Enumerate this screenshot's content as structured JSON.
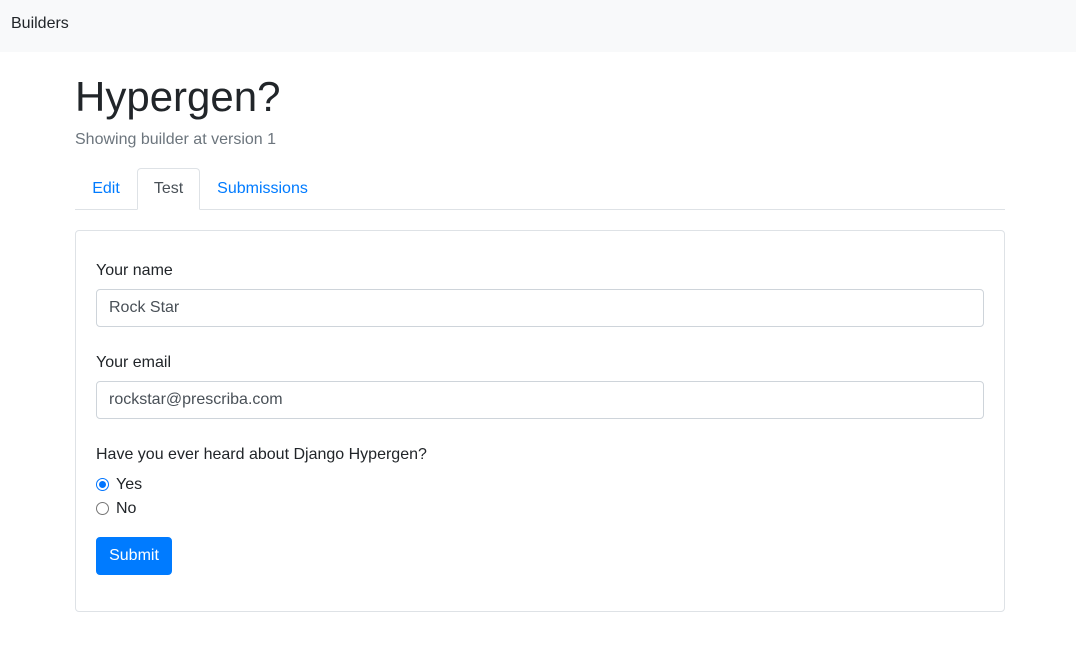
{
  "navbar": {
    "brand": "Builders"
  },
  "page": {
    "title": "Hypergen?",
    "subtitle": "Showing builder at version 1"
  },
  "tabs": [
    {
      "label": "Edit",
      "active": false
    },
    {
      "label": "Test",
      "active": true
    },
    {
      "label": "Submissions",
      "active": false
    }
  ],
  "form": {
    "name_label": "Your name",
    "name_value": "Rock Star",
    "email_label": "Your email",
    "email_value": "rockstar@prescriba.com",
    "question_label": "Have you ever heard about Django Hypergen?",
    "options": [
      {
        "label": "Yes",
        "checked": true
      },
      {
        "label": "No",
        "checked": false
      }
    ],
    "submit_label": "Submit"
  },
  "colors": {
    "primary": "#007bff",
    "navbar_bg": "#f8f9fa",
    "muted": "#6c757d",
    "border": "#dee2e6"
  }
}
